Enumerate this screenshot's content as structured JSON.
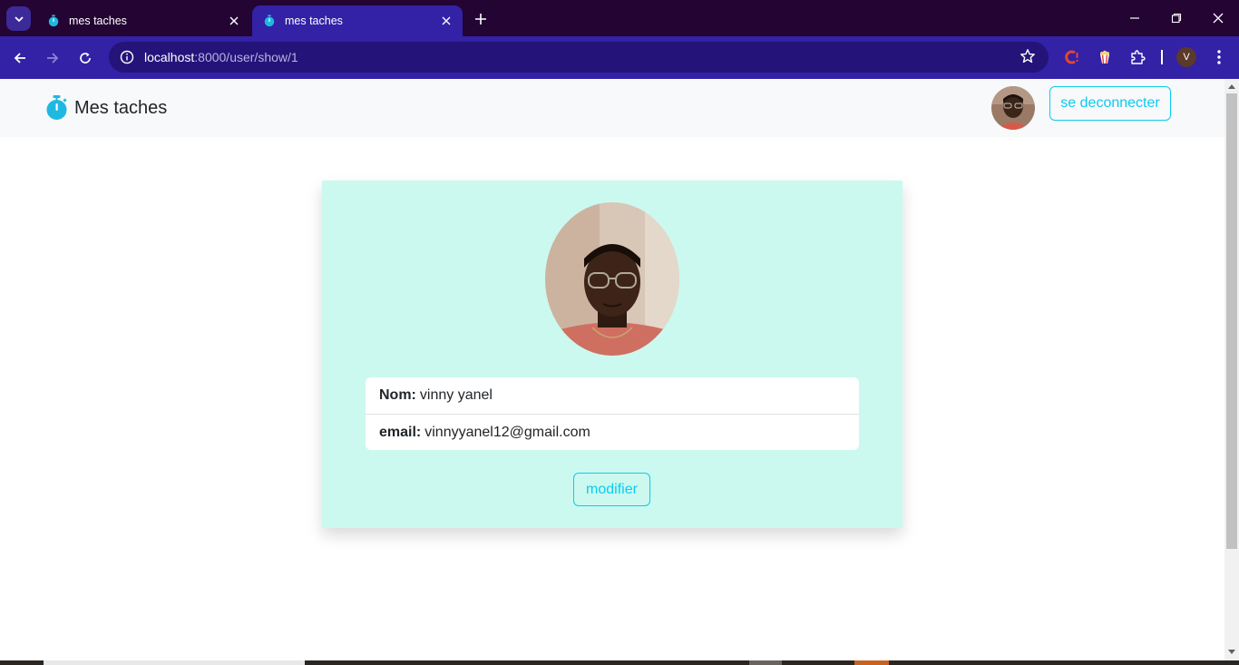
{
  "browser": {
    "tabs": [
      {
        "title": "mes taches",
        "active": false
      },
      {
        "title": "mes taches",
        "active": true
      }
    ],
    "url_host": "localhost",
    "url_path": ":8000/user/show/1",
    "profile_initial": "V"
  },
  "navbar": {
    "brand": "Mes taches",
    "logout_label": "se deconnecter"
  },
  "profile": {
    "name_label": "Nom:",
    "name_value": "vinny yanel",
    "email_label": "email:",
    "email_value": "vinnyyanel12@gmail.com",
    "edit_label": "modifier"
  },
  "colors": {
    "accent": "#0dcaf0",
    "card_bg": "#cbf9ef",
    "chrome_dark": "#230433",
    "chrome_bar": "#3321a6"
  }
}
